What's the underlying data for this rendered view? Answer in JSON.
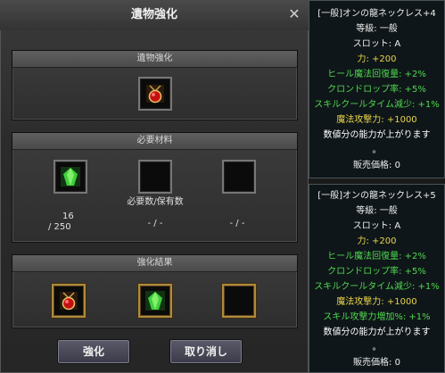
{
  "dialog": {
    "title": "遺物強化",
    "panels": {
      "relic": "遺物強化",
      "materials": "必要材料",
      "materials_sub": "必要数/保有数",
      "result": "強化結果"
    },
    "material_counts": [
      {
        "need": "16",
        "have": "/ 250"
      },
      {
        "text": "- / -"
      },
      {
        "text": "- / -"
      }
    ],
    "buttons": {
      "enhance": "強化",
      "cancel": "取り消し"
    }
  },
  "tooltips": [
    {
      "name": "[一般]オンの龍ネックレス+4",
      "grade": "等級: 一般",
      "slot": "スロット: A",
      "stats": [
        "力: +200",
        "ヒール魔法回復量: +2%",
        "クロンドロップ率: +5%",
        "スキルクールタイム減少: +1%",
        "魔法攻撃力: +1000"
      ],
      "desc1": "数値分の能力が上がります",
      "desc2": "。",
      "price": "販売価格: 0"
    },
    {
      "name": "[一般]オンの龍ネックレス+5",
      "grade": "等級: 一般",
      "slot": "スロット: A",
      "stats": [
        "力: +200",
        "ヒール魔法回復量: +2%",
        "クロンドロップ率: +5%",
        "スキルクールタイム減少: +1%",
        "魔法攻撃力: +1000",
        "スキル攻撃力増加%: +1%"
      ],
      "desc1": "数値分の能力が上がります",
      "desc2": "。",
      "price": "販売価格: 0"
    }
  ],
  "colors": {
    "stat_green": "#4fd84f",
    "attr_yellow": "#e8d44a",
    "slot_gold": "#b08a3c"
  }
}
